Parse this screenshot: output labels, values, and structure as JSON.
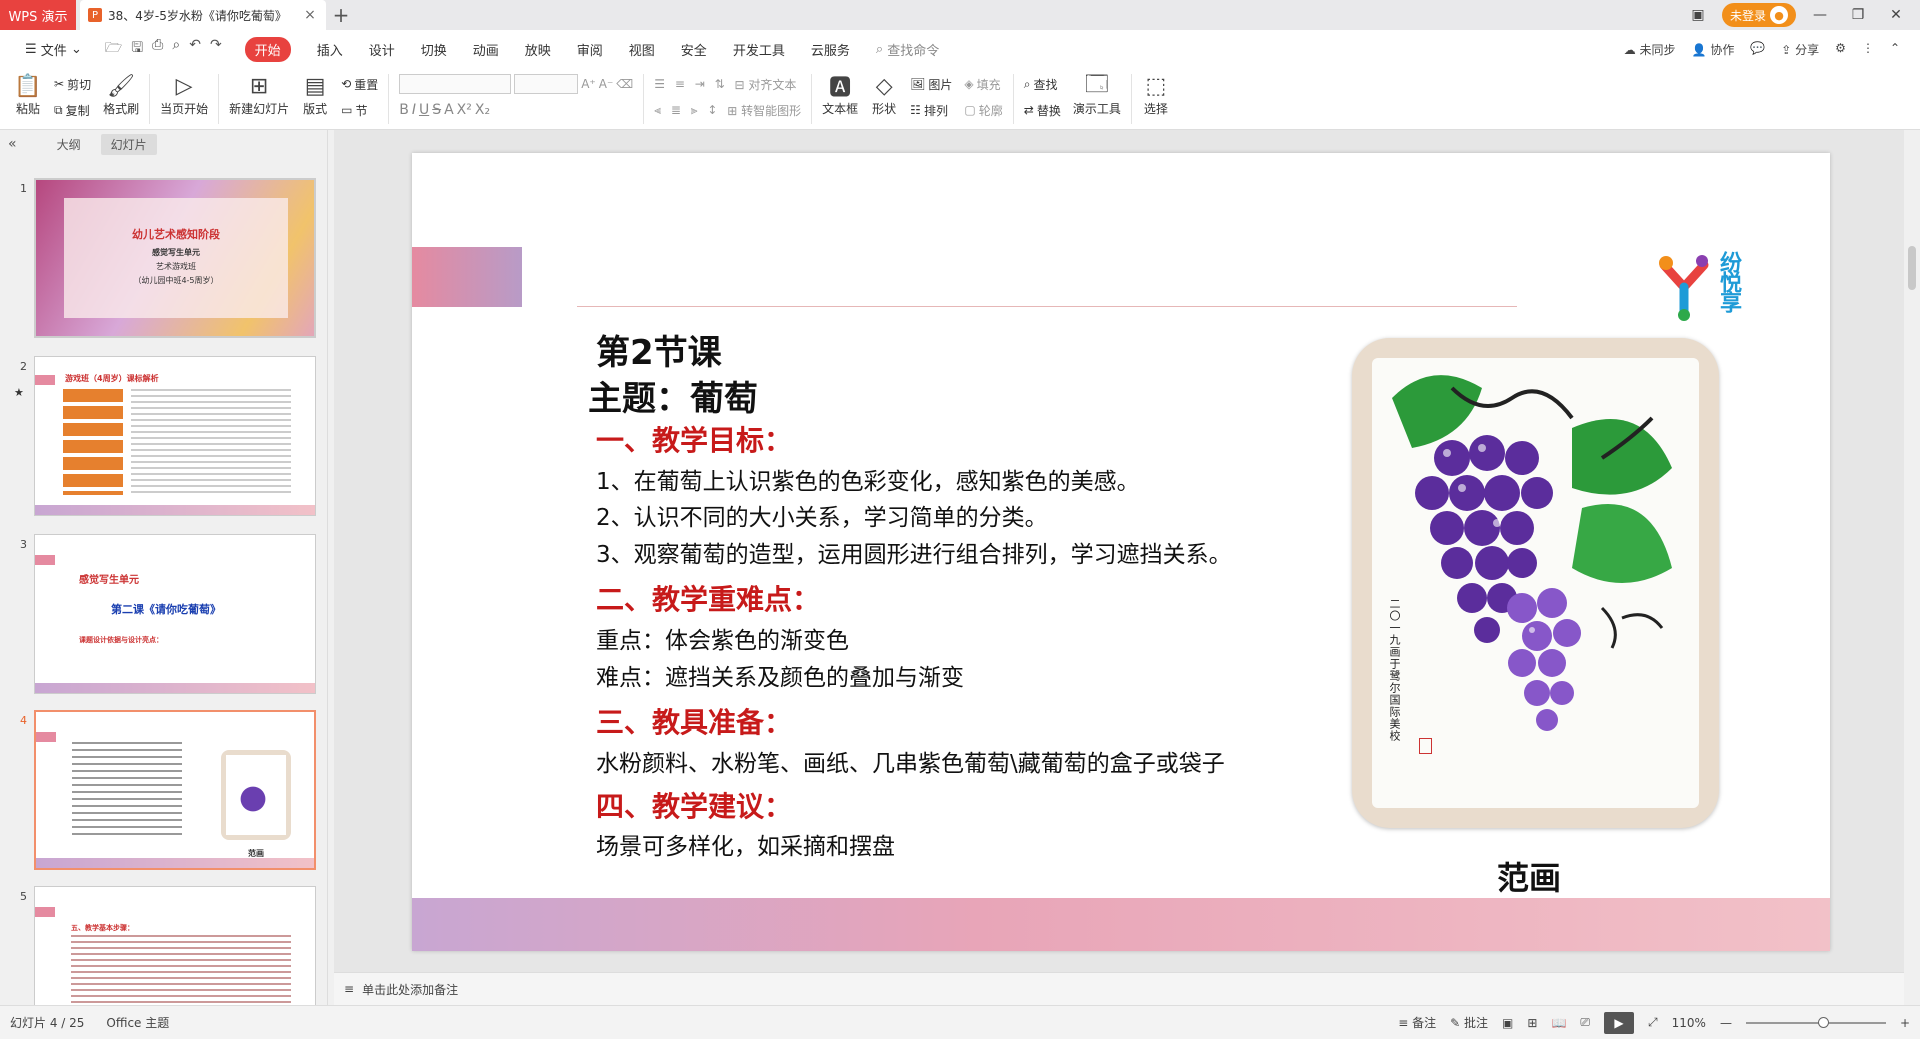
{
  "app": {
    "brand": "WPS 演示",
    "doc_tab_title": "38、4岁-5岁水粉《请你吃葡萄》",
    "login": "未登录"
  },
  "menu": {
    "file": "文件",
    "items": [
      "开始",
      "插入",
      "设计",
      "切换",
      "动画",
      "放映",
      "审阅",
      "视图",
      "安全",
      "开发工具",
      "云服务"
    ],
    "search": "查找命令",
    "right": [
      "未同步",
      "协作",
      "分享"
    ]
  },
  "ribbon": {
    "paste": "粘贴",
    "cut": "剪切",
    "copy": "复制",
    "format_painter": "格式刷",
    "from_start": "当页开始",
    "new_slide": "新建幻灯片",
    "layout": "版式",
    "reset": "重置",
    "section": "节",
    "align_text": "对齐文本",
    "smart_art": "转智能图形",
    "textbox": "文本框",
    "shape": "形状",
    "picture": "图片",
    "fill": "填充",
    "arrange": "排列",
    "outline": "轮廓",
    "find": "查找",
    "replace": "替换",
    "present_tools": "演示工具",
    "select": "选择"
  },
  "left_panel": {
    "tabs": [
      "大纲",
      "幻灯片"
    ],
    "slide_numbers": [
      "1",
      "2",
      "3",
      "4",
      "5"
    ],
    "s1": {
      "title": "幼儿艺术感知阶段",
      "sub1": "感觉写生单元",
      "sub2": "艺术游戏班",
      "sub3": "（幼儿园中班4-5周岁）"
    },
    "s2": {
      "title": "游戏班（4周岁）课标解析"
    },
    "s3": {
      "t1": "感觉写生单元",
      "t2": "第二课《请你吃葡萄》",
      "t3": "课题设计依据与设计亮点："
    },
    "s4": {
      "caption": "范画"
    },
    "s5": {
      "title": "五、教学基本步骤："
    }
  },
  "slide": {
    "lesson": "第2节课",
    "theme": "主题：葡萄",
    "h_goal": "一、教学目标：",
    "goals": [
      "1、在葡萄上认识紫色的色彩变化，感知紫色的美感。",
      "2、认识不同的大小关系，学习简单的分类。",
      "3、观察葡萄的造型，运用圆形进行组合排列，学习遮挡关系。"
    ],
    "h_key": "二、教学重难点：",
    "keys": [
      "重点：体会紫色的渐变色",
      "难点：遮挡关系及颜色的叠加与渐变"
    ],
    "h_tools": "三、教具准备：",
    "tools": "水粉颜料、水粉笔、画纸、几串紫色葡萄\\藏葡萄的盒子或袋子",
    "h_advice": "四、教学建议：",
    "advice": "场景可多样化，如采摘和摆盘",
    "caption": "范画",
    "logo_text": "纷悦享",
    "inscription": "二〇一九画于鹭尔国际美校"
  },
  "notes_placeholder": "单击此处添加备注",
  "status": {
    "slide_count": "幻灯片 4 / 25",
    "theme": "Office 主题",
    "notes": "备注",
    "comments": "批注",
    "zoom": "110%"
  }
}
